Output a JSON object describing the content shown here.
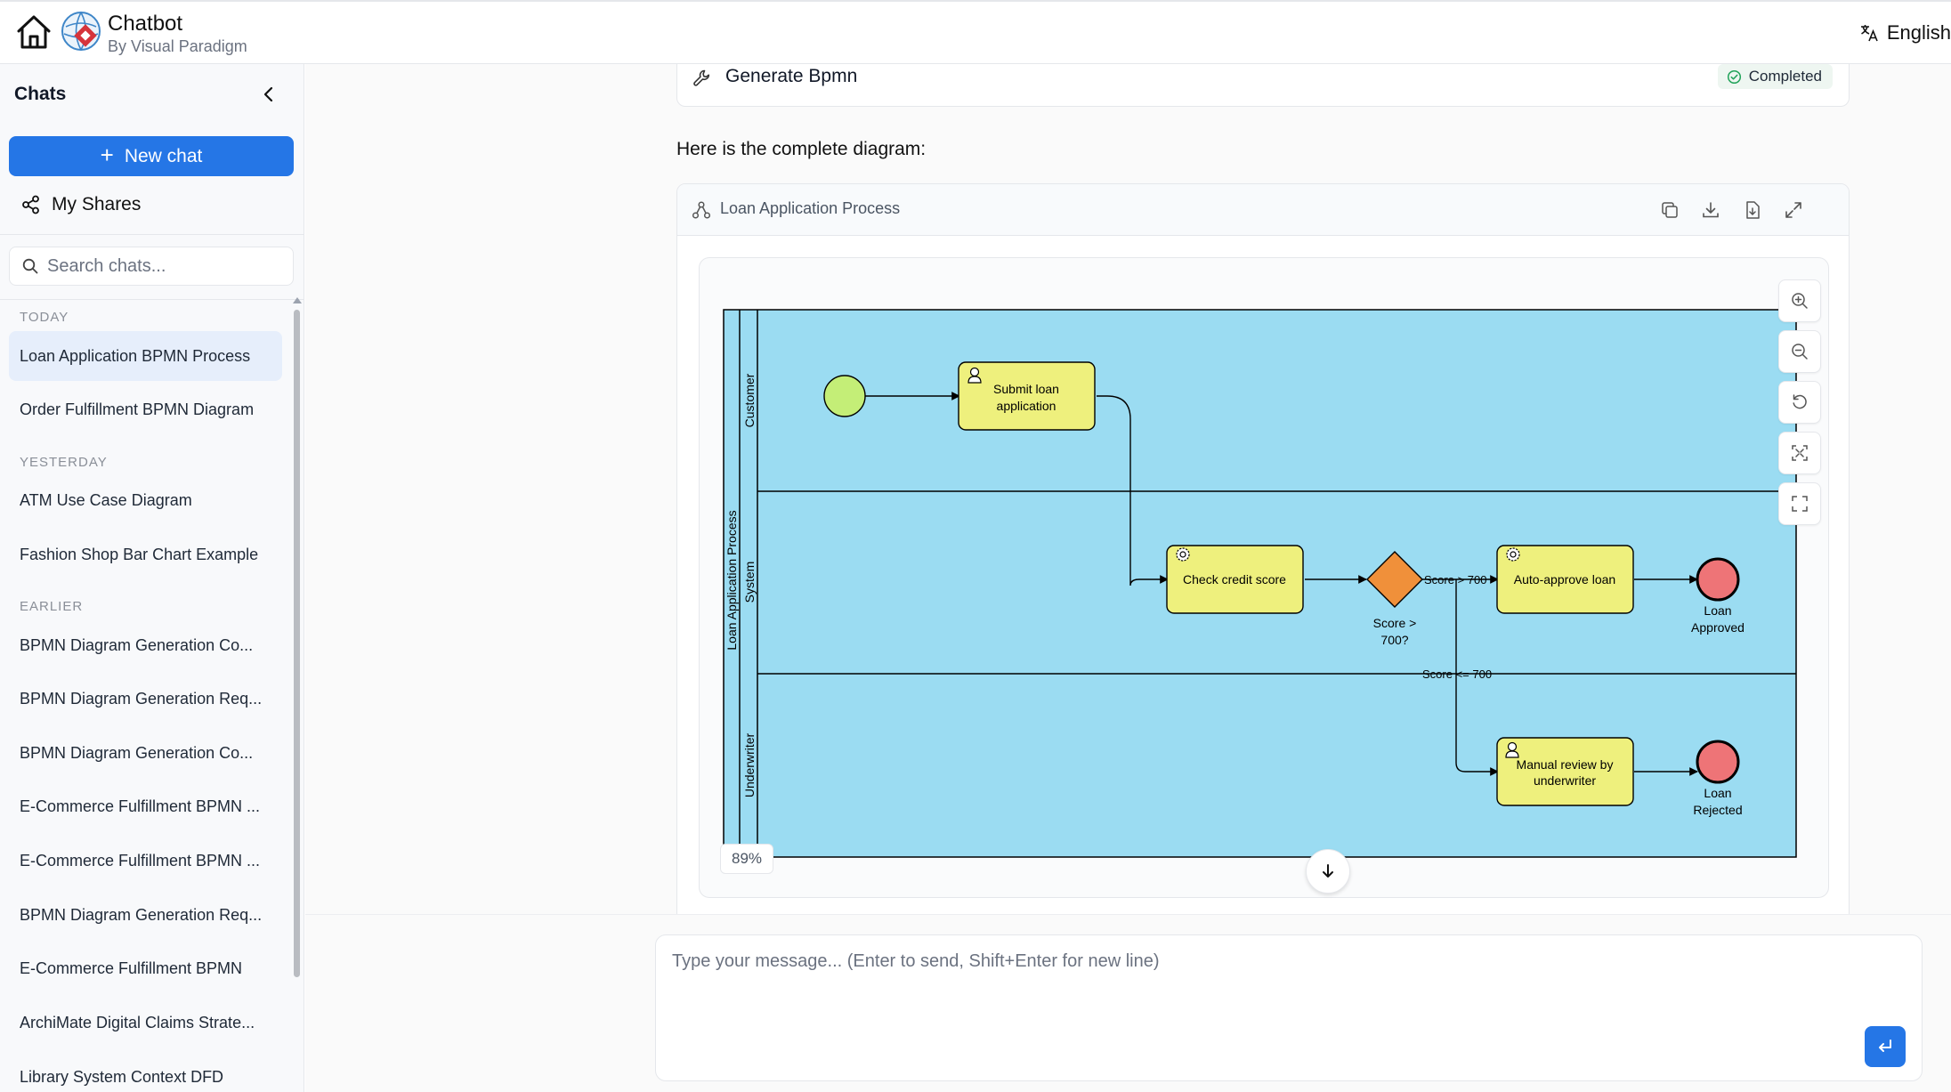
{
  "header": {
    "app_title": "Chatbot",
    "app_subtitle": "By Visual Paradigm",
    "language": "English"
  },
  "sidebar": {
    "title": "Chats",
    "new_chat_label": "New chat",
    "my_shares_label": "My Shares",
    "search_placeholder": "Search chats...",
    "groups": [
      {
        "label": "TODAY",
        "items": [
          "Loan Application BPMN Process",
          "Order Fulfillment BPMN Diagram"
        ]
      },
      {
        "label": "YESTERDAY",
        "items": [
          "ATM Use Case Diagram",
          "Fashion Shop Bar Chart Example"
        ]
      },
      {
        "label": "EARLIER",
        "items": [
          "BPMN Diagram Generation Co...",
          "BPMN Diagram Generation Req...",
          "BPMN Diagram Generation Co...",
          "E-Commerce Fulfillment BPMN ...",
          "E-Commerce Fulfillment BPMN ...",
          "BPMN Diagram Generation Req...",
          "E-Commerce Fulfillment BPMN",
          "ArchiMate Digital Claims Strate...",
          "Library System Context DFD"
        ]
      }
    ],
    "active_item": "Loan Application BPMN Process"
  },
  "main": {
    "tool_name": "Generate Bpmn",
    "tool_status": "Completed",
    "intro_text": "Here is the complete diagram:",
    "diagram": {
      "title": "Loan Application Process",
      "zoom_level": "89%",
      "pool_label": "Loan Application Process",
      "lanes": [
        "Customer",
        "System",
        "Underwriter"
      ],
      "tasks": {
        "submit_line1": "Submit loan",
        "submit_line2": "application",
        "check": "Check credit score",
        "approve": "Auto-approve loan",
        "review_line1": "Manual review by",
        "review_line2": "underwriter"
      },
      "gateway_line1": "Score >",
      "gateway_line2": "700?",
      "flow_yes": "Score > 700",
      "flow_no": "Score <= 700",
      "end_approved_line1": "Loan",
      "end_approved_line2": "Approved",
      "end_rejected_line1": "Loan",
      "end_rejected_line2": "Rejected"
    }
  },
  "composer": {
    "placeholder": "Type your message... (Enter to send, Shift+Enter for new line)"
  },
  "colors": {
    "accent": "#2576e6",
    "pool_fill": "#9bdcf2",
    "task_fill": "#eef07d",
    "gateway_fill": "#f0903a",
    "start_fill": "#c4ee77",
    "end_fill": "#ee7477"
  }
}
